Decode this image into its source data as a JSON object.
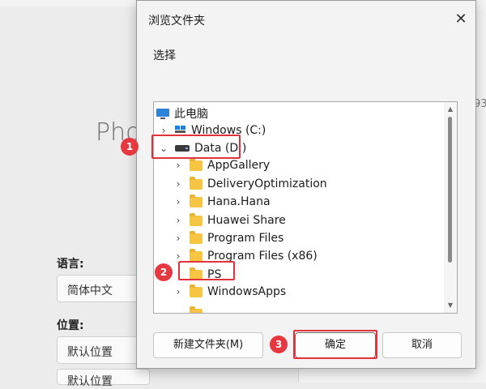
{
  "background": {
    "title_partial": "Pho",
    "right_num": "93",
    "language_label": "语言:",
    "language_value": "简体中文",
    "location_label": "位置:",
    "location_value": "默认位置",
    "location_value2": "默认位置"
  },
  "dialog": {
    "title": "浏览文件夹",
    "close": "✕",
    "description": "选择",
    "tree": [
      {
        "label": "此电脑",
        "icon": "computer-icon"
      },
      {
        "label": "Windows (C:)",
        "icon": "windows-drive-icon"
      },
      {
        "label": "Data (D:)",
        "icon": "drive-icon"
      },
      {
        "label": "AppGallery",
        "icon": "folder-icon"
      },
      {
        "label": "DeliveryOptimization",
        "icon": "folder-icon"
      },
      {
        "label": "Hana.Hana",
        "icon": "folder-icon"
      },
      {
        "label": "Huawei Share",
        "icon": "folder-icon"
      },
      {
        "label": "Program Files",
        "icon": "folder-icon"
      },
      {
        "label": "Program Files (x86)",
        "icon": "folder-icon"
      },
      {
        "label": "PS",
        "icon": "folder-icon"
      },
      {
        "label": "WindowsApps",
        "icon": "folder-icon"
      }
    ],
    "buttons": {
      "new_folder": "新建文件夹(M)",
      "ok": "确定",
      "cancel": "取消"
    }
  },
  "annotations": {
    "step1": "1",
    "step2": "2",
    "step3": "3",
    "color": "#e2333a"
  }
}
